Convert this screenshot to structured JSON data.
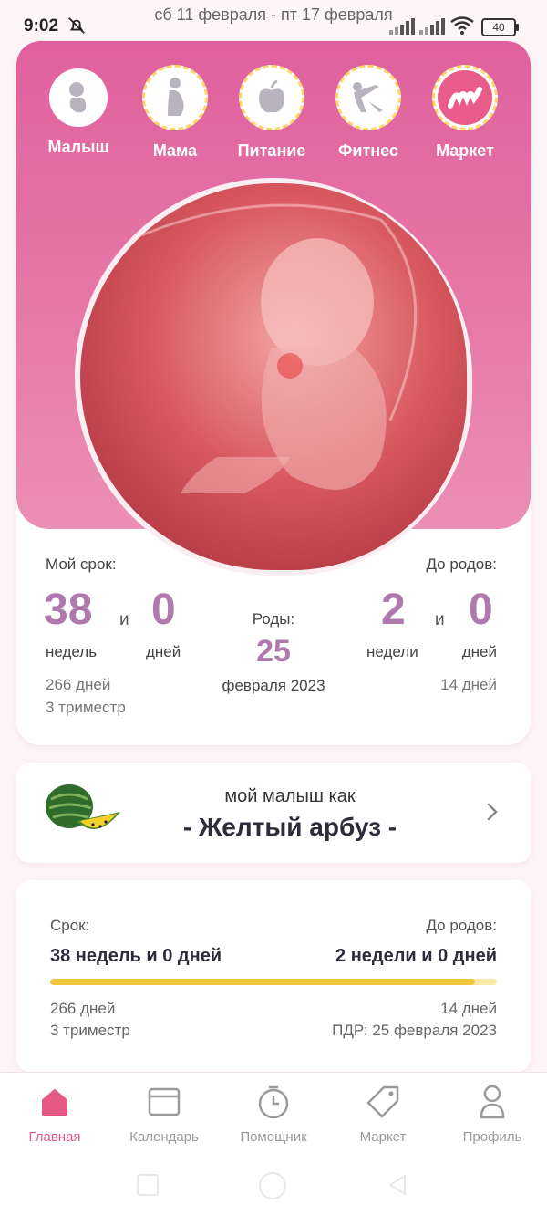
{
  "status_bar": {
    "time": "9:02",
    "week_range": "сб 11 февраля - пт 17 февраля",
    "battery": "40"
  },
  "top_nav": {
    "items": [
      {
        "label": "Малыш",
        "icon": "baby-icon"
      },
      {
        "label": "Мама",
        "icon": "pregnant-mom-icon"
      },
      {
        "label": "Питание",
        "icon": "apple-icon"
      },
      {
        "label": "Фитнес",
        "icon": "fitness-icon"
      },
      {
        "label": "Маркет",
        "icon": "market-logo-icon"
      }
    ]
  },
  "pregnancy": {
    "my_term_label": "Мой срок:",
    "weeks": "38",
    "and": "и",
    "days": "0",
    "weeks_unit": "недель",
    "days_unit": "дней",
    "total_days": "266 дней",
    "trimester": "3 триместр",
    "birth_label": "Роды:",
    "due_day": "25",
    "due_month": "февраля 2023",
    "until_birth_label": "До родов:",
    "left_weeks": "2",
    "left_days": "0",
    "left_weeks_unit": "недели",
    "left_days_unit": "дней",
    "left_total_days": "14 дней"
  },
  "baby_size": {
    "subtitle": "мой малыш как",
    "title": "- Желтый арбуз -"
  },
  "progress": {
    "term_label": "Срок:",
    "term_value": "38 недель и 0 дней",
    "until_label": "До родов:",
    "until_value": "2 недели и 0 дней",
    "fraction": 0.95,
    "days": "266 дней",
    "trimester": "3 триместр",
    "days_left": "14 дней",
    "pdr": "ПДР: 25 февраля 2023"
  },
  "bottom_nav": {
    "items": [
      {
        "label": "Главная",
        "icon": "home-icon",
        "active": true
      },
      {
        "label": "Календарь",
        "icon": "calendar-icon"
      },
      {
        "label": "Помощник",
        "icon": "timer-icon"
      },
      {
        "label": "Маркет",
        "icon": "tag-icon"
      },
      {
        "label": "Профиль",
        "icon": "profile-icon"
      }
    ]
  },
  "colors": {
    "accent": "#b079ae",
    "pink_header": "#e0609e",
    "active_nav": "#e45a85",
    "progress": "#f0c73d"
  }
}
